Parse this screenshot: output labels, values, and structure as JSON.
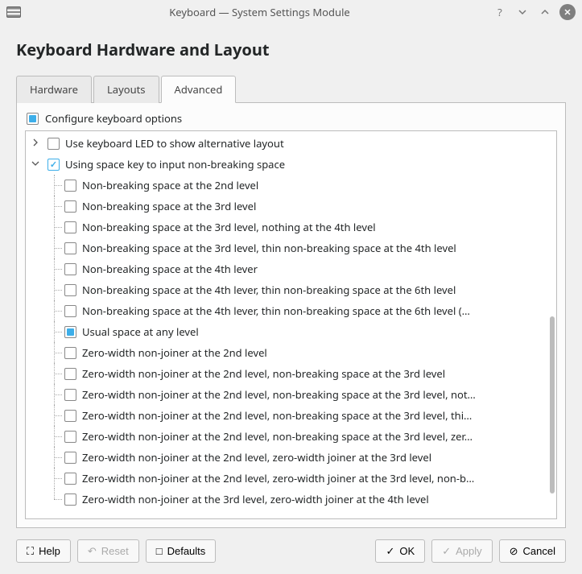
{
  "window": {
    "title": "Keyboard — System Settings Module"
  },
  "header": {
    "page_title": "Keyboard Hardware and Layout"
  },
  "tabs": {
    "hardware": "Hardware",
    "layouts": "Layouts",
    "advanced": "Advanced"
  },
  "configure": {
    "label": "Configure keyboard options"
  },
  "tree": {
    "items": [
      {
        "level": 0,
        "expander": "right",
        "check": "none",
        "label": "Use keyboard LED to show alternative layout"
      },
      {
        "level": 0,
        "expander": "down",
        "check": "tick",
        "label": "Using space key to input non-breaking space"
      },
      {
        "level": 1,
        "check": "none",
        "label": "Non-breaking space at the 2nd level"
      },
      {
        "level": 1,
        "check": "none",
        "label": "Non-breaking space at the 3rd level"
      },
      {
        "level": 1,
        "check": "none",
        "label": "Non-breaking space at the 3rd level, nothing at the 4th level"
      },
      {
        "level": 1,
        "check": "none",
        "label": "Non-breaking space at the 3rd level, thin non-breaking space at the 4th level"
      },
      {
        "level": 1,
        "check": "none",
        "label": "Non-breaking space at the 4th lever"
      },
      {
        "level": 1,
        "check": "none",
        "label": "Non-breaking space at the 4th lever, thin non-breaking space at the 6th level"
      },
      {
        "level": 1,
        "check": "none",
        "label": "Non-breaking space at the 4th lever, thin non-breaking space at the 6th level (…"
      },
      {
        "level": 1,
        "check": "fill",
        "label": "Usual space at any level"
      },
      {
        "level": 1,
        "check": "none",
        "label": "Zero-width non-joiner at the 2nd level"
      },
      {
        "level": 1,
        "check": "none",
        "label": "Zero-width non-joiner at the 2nd level, non-breaking space at the 3rd level"
      },
      {
        "level": 1,
        "check": "none",
        "label": "Zero-width non-joiner at the 2nd level, non-breaking space at the 3rd level, not…"
      },
      {
        "level": 1,
        "check": "none",
        "label": "Zero-width non-joiner at the 2nd level, non-breaking space at the 3rd level, thi…"
      },
      {
        "level": 1,
        "check": "none",
        "label": "Zero-width non-joiner at the 2nd level, non-breaking space at the 3rd level, zer…"
      },
      {
        "level": 1,
        "check": "none",
        "label": "Zero-width non-joiner at the 2nd level, zero-width joiner at the 3rd level"
      },
      {
        "level": 1,
        "check": "none",
        "label": "Zero-width non-joiner at the 2nd level, zero-width joiner at the 3rd level, non-b…"
      },
      {
        "level": 1,
        "check": "none",
        "label": "Zero-width non-joiner at the 3rd level, zero-width joiner at the 4th level"
      }
    ]
  },
  "buttons": {
    "help": "Help",
    "reset": "Reset",
    "defaults": "Defaults",
    "ok": "OK",
    "apply": "Apply",
    "cancel": "Cancel"
  }
}
